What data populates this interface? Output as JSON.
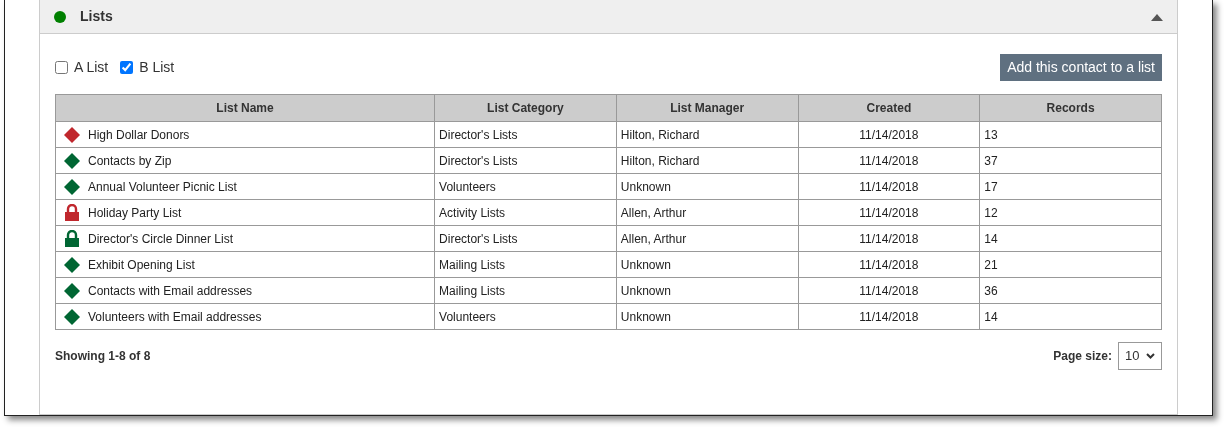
{
  "panel": {
    "title": "Lists",
    "color": "#008000",
    "expanded": true
  },
  "filters": [
    {
      "label": "A List",
      "checked": false
    },
    {
      "label": "B List",
      "checked": true
    }
  ],
  "add_button": "Add this contact to a list",
  "table": {
    "columns": [
      "List Name",
      "List Category",
      "List Manager",
      "Created",
      "Records"
    ],
    "rows": [
      {
        "kind": "diamond",
        "color": "#c0272d",
        "name": "High Dollar Donors",
        "category": "Director's Lists",
        "manager": "Hilton, Richard",
        "created": "11/14/2018",
        "records": "13"
      },
      {
        "kind": "diamond",
        "color": "#006633",
        "name": "Contacts by Zip",
        "category": "Director's Lists",
        "manager": "Hilton, Richard",
        "created": "11/14/2018",
        "records": "37"
      },
      {
        "kind": "diamond",
        "color": "#006633",
        "name": "Annual Volunteer Picnic List",
        "category": "Volunteers",
        "manager": "Unknown",
        "created": "11/14/2018",
        "records": "17"
      },
      {
        "kind": "lock",
        "color": "#c0272d",
        "name": "Holiday Party List",
        "category": "Activity Lists",
        "manager": "Allen, Arthur",
        "created": "11/14/2018",
        "records": "12"
      },
      {
        "kind": "lock",
        "color": "#006633",
        "name": "Director's Circle Dinner List",
        "category": "Director's Lists",
        "manager": "Allen, Arthur",
        "created": "11/14/2018",
        "records": "14"
      },
      {
        "kind": "diamond",
        "color": "#006633",
        "name": "Exhibit Opening List",
        "category": "Mailing Lists",
        "manager": "Unknown",
        "created": "11/14/2018",
        "records": "21"
      },
      {
        "kind": "diamond",
        "color": "#006633",
        "name": "Contacts with Email addresses",
        "category": "Mailing Lists",
        "manager": "Unknown",
        "created": "11/14/2018",
        "records": "36"
      },
      {
        "kind": "diamond",
        "color": "#006633",
        "name": "Volunteers with Email addresses",
        "category": "Volunteers",
        "manager": "Unknown",
        "created": "11/14/2018",
        "records": "14"
      }
    ]
  },
  "showing": "Showing 1-8 of 8",
  "page_size": {
    "label": "Page size:",
    "value": "10"
  }
}
